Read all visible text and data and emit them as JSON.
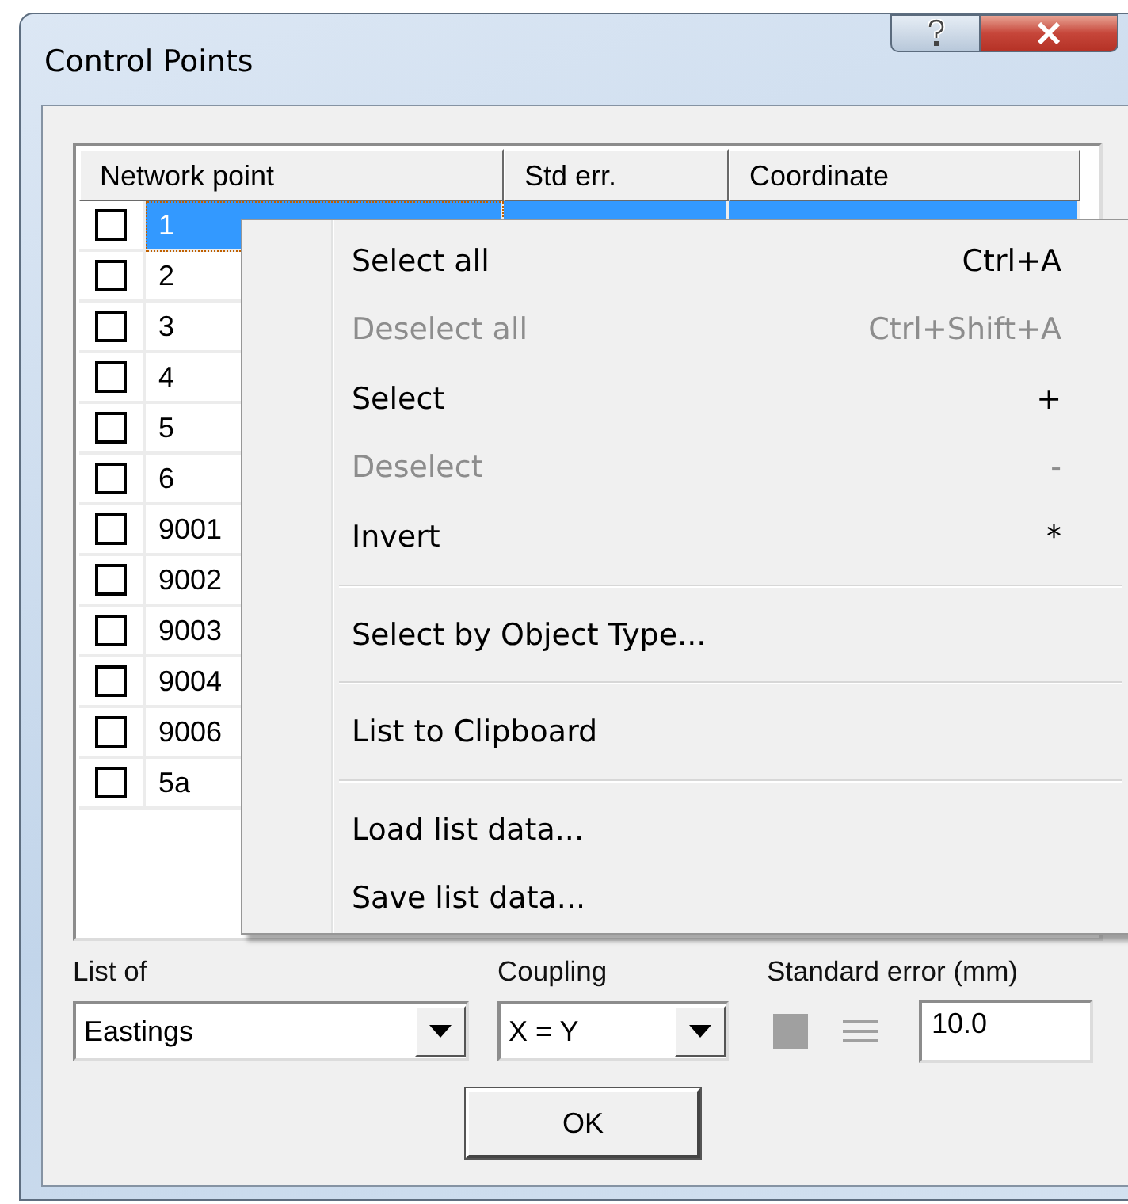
{
  "window": {
    "title": "Control Points"
  },
  "table": {
    "columns": [
      "Network point",
      "Std err.",
      "Coordinate"
    ],
    "rows": [
      {
        "name": "1",
        "checked": false,
        "selected": true
      },
      {
        "name": "2",
        "checked": false,
        "selected": false
      },
      {
        "name": "3",
        "checked": false,
        "selected": false
      },
      {
        "name": "4",
        "checked": false,
        "selected": false
      },
      {
        "name": "5",
        "checked": false,
        "selected": false
      },
      {
        "name": "6",
        "checked": false,
        "selected": false
      },
      {
        "name": "9001",
        "checked": false,
        "selected": false
      },
      {
        "name": "9002",
        "checked": false,
        "selected": false
      },
      {
        "name": "9003",
        "checked": false,
        "selected": false
      },
      {
        "name": "9004",
        "checked": false,
        "selected": false
      },
      {
        "name": "9006",
        "checked": false,
        "selected": false
      },
      {
        "name": "5a",
        "checked": false,
        "selected": false
      }
    ]
  },
  "context_menu": {
    "groups": [
      [
        {
          "label": "Select all",
          "shortcut": "Ctrl+A",
          "disabled": false
        },
        {
          "label": "Deselect all",
          "shortcut": "Ctrl+Shift+A",
          "disabled": true
        },
        {
          "label": "Select",
          "shortcut": "+",
          "disabled": false
        },
        {
          "label": "Deselect",
          "shortcut": "-",
          "disabled": true
        },
        {
          "label": "Invert",
          "shortcut": "*",
          "disabled": false
        }
      ],
      [
        {
          "label": "Select by Object Type...",
          "disabled": false
        }
      ],
      [
        {
          "label": "List to Clipboard",
          "disabled": false
        }
      ],
      [
        {
          "label": "Load list data...",
          "disabled": false
        },
        {
          "label": "Save list data...",
          "disabled": false
        }
      ]
    ]
  },
  "list_of": {
    "label": "List of",
    "value": "Eastings"
  },
  "coupling": {
    "label": "Coupling",
    "value": "X = Y"
  },
  "standard_error": {
    "label": "Standard error (mm)",
    "value": "10.0"
  },
  "buttons": [
    "OK"
  ]
}
